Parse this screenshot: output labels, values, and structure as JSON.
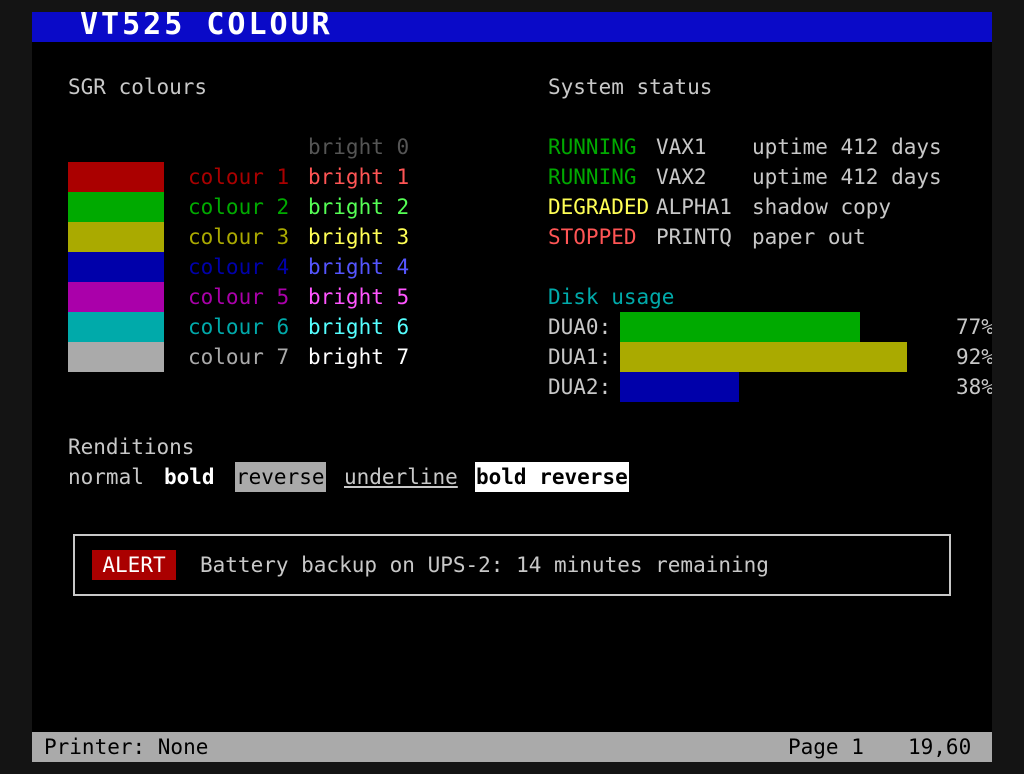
{
  "title": "VT525 COLOUR",
  "sgr": {
    "heading": "SGR colours",
    "bright0": "bright 0",
    "rows": [
      {
        "normal": "colour 1",
        "bright": "bright 1",
        "swatch": "#aa0000",
        "normal_color": "#aa0000",
        "bright_color": "#ff5555"
      },
      {
        "normal": "colour 2",
        "bright": "bright 2",
        "swatch": "#00aa00",
        "normal_color": "#00aa00",
        "bright_color": "#55ff55"
      },
      {
        "normal": "colour 3",
        "bright": "bright 3",
        "swatch": "#aaaa00",
        "normal_color": "#aaaa00",
        "bright_color": "#ffff55"
      },
      {
        "normal": "colour 4",
        "bright": "bright 4",
        "swatch": "#0000aa",
        "normal_color": "#0000aa",
        "bright_color": "#5555ff"
      },
      {
        "normal": "colour 5",
        "bright": "bright 5",
        "swatch": "#aa00aa",
        "normal_color": "#aa00aa",
        "bright_color": "#ff55ff"
      },
      {
        "normal": "colour 6",
        "bright": "bright 6",
        "swatch": "#00aaaa",
        "normal_color": "#00aaaa",
        "bright_color": "#55ffff"
      },
      {
        "normal": "colour 7",
        "bright": "bright 7",
        "swatch": "#aaaaaa",
        "normal_color": "#aaaaaa",
        "bright_color": "#ffffff"
      }
    ]
  },
  "system_status": {
    "heading": "System status",
    "rows": [
      {
        "state": "RUNNING",
        "host": "VAX1",
        "detail": "uptime 412 days",
        "state_color": "#00aa00"
      },
      {
        "state": "RUNNING",
        "host": "VAX2",
        "detail": "uptime 412 days",
        "state_color": "#00aa00"
      },
      {
        "state": "DEGRADED",
        "host": "ALPHA1",
        "detail": "shadow copy",
        "state_color": "#ffff55"
      },
      {
        "state": "STOPPED",
        "host": "PRINTQ",
        "detail": "paper out",
        "state_color": "#ff5555"
      }
    ]
  },
  "disk": {
    "heading": "Disk usage",
    "heading_color": "#00aaaa",
    "rows": [
      {
        "label": "DUA0:",
        "percent": 77,
        "percent_text": "77%",
        "color": "#00aa00"
      },
      {
        "label": "DUA1:",
        "percent": 92,
        "percent_text": "92%",
        "color": "#aaaa00"
      },
      {
        "label": "DUA2:",
        "percent": 38,
        "percent_text": "38%",
        "color": "#0000aa"
      }
    ]
  },
  "renditions": {
    "heading": "Renditions",
    "normal": "normal",
    "bold": "bold",
    "reverse": "reverse",
    "underline": "underline",
    "bold_reverse": "bold reverse"
  },
  "alert": {
    "badge": "ALERT",
    "badge_color": "#aa0000",
    "message": "Battery backup on UPS-2: 14 minutes remaining"
  },
  "status_bar": {
    "printer": "Printer: None",
    "page": "Page 1",
    "cursor": "19,60"
  },
  "colors": {
    "screen_bg": "#000000",
    "title_bar": "#0a0ac8",
    "foreground": "#c8c8c8",
    "status_bar": "#aaaaaa"
  }
}
